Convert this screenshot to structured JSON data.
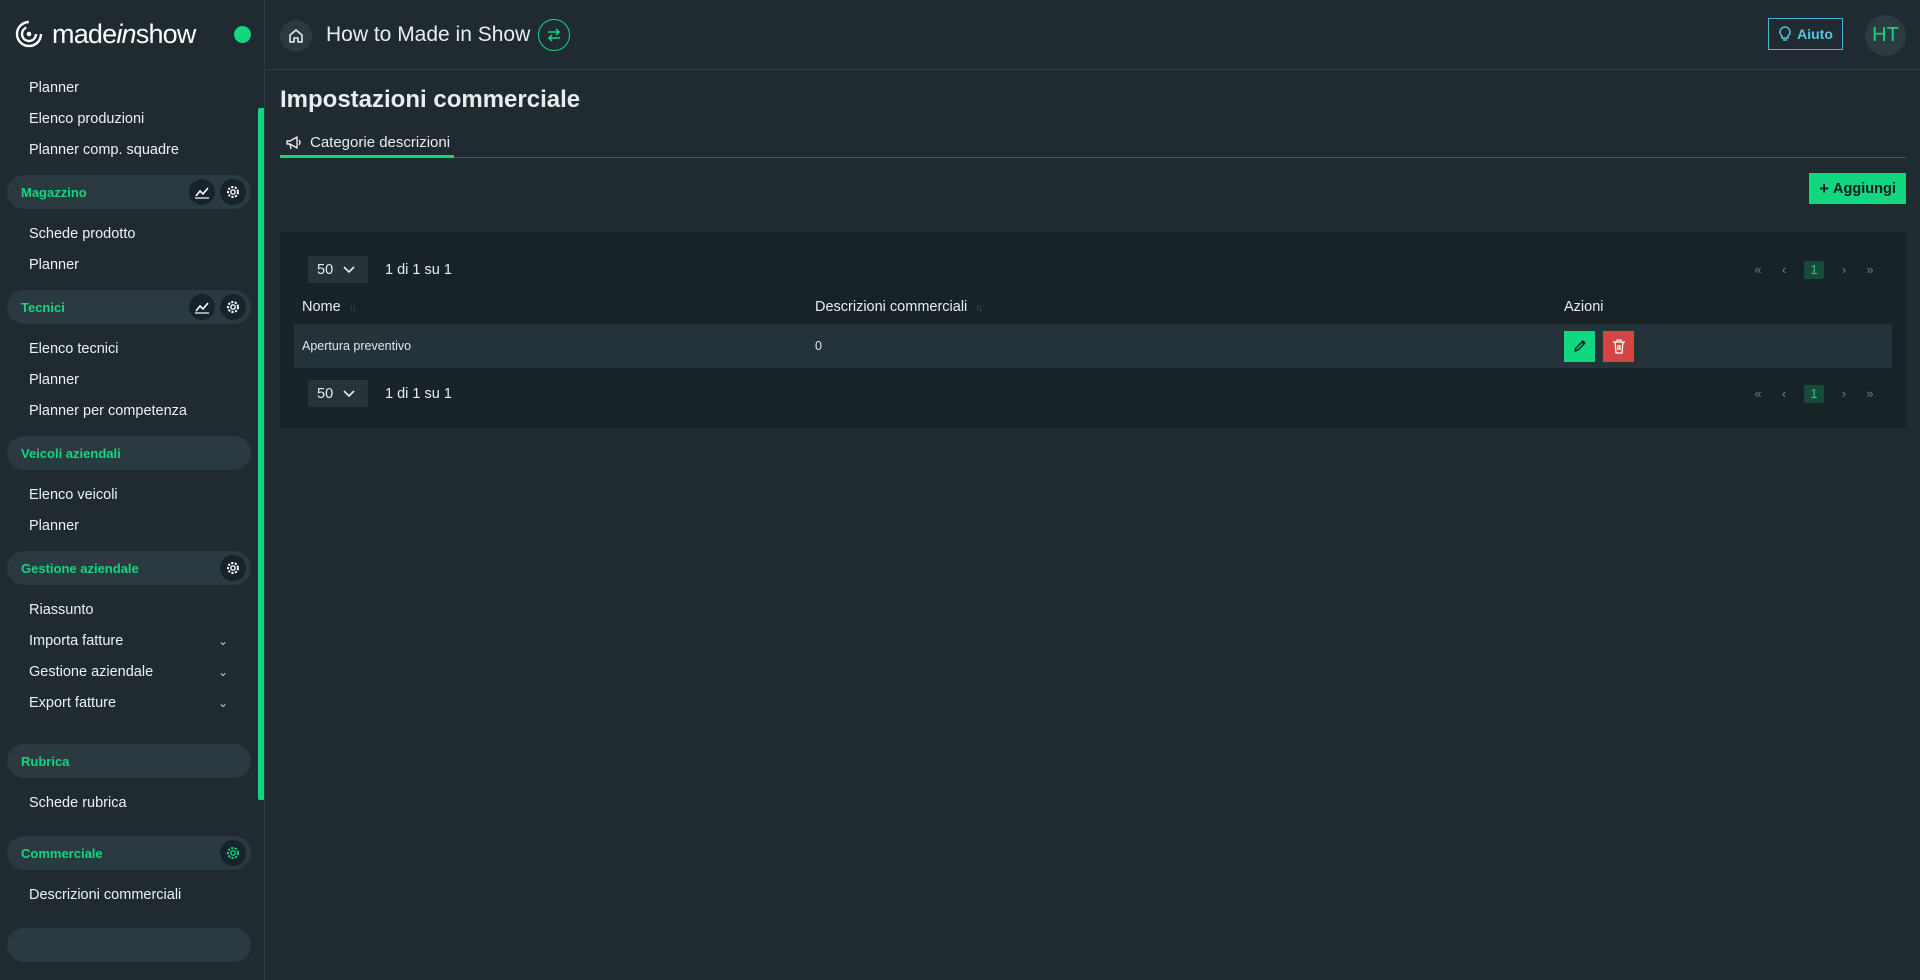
{
  "brand": {
    "name_pre": "made",
    "name_it": "in",
    "name_post": "show"
  },
  "colors": {
    "accent": "#13d680",
    "background": "#1f2b30",
    "danger": "#d64545",
    "help": "#56c6e0"
  },
  "sidebar": {
    "top_items": [
      "Planner",
      "Elenco produzioni",
      "Planner comp. squadre"
    ],
    "groups": [
      {
        "label": "Magazzino",
        "icons": [
          "chart-icon",
          "gear-icon"
        ],
        "items": [
          "Schede prodotto",
          "Planner"
        ]
      },
      {
        "label": "Tecnici",
        "icons": [
          "chart-icon",
          "gear-icon"
        ],
        "items": [
          "Elenco tecnici",
          "Planner",
          "Planner per competenza"
        ]
      },
      {
        "label": "Veicoli aziendali",
        "icons": [],
        "items": [
          "Elenco veicoli",
          "Planner"
        ]
      },
      {
        "label": "Gestione aziendale",
        "icons": [
          "gear-icon"
        ],
        "items": [
          "Riassunto",
          "Importa fatture",
          "Gestione aziendale",
          "Export fatture"
        ]
      },
      {
        "label": "Rubrica",
        "icons": [],
        "items": [
          "Schede rubrica"
        ]
      },
      {
        "label": "Commerciale",
        "icons": [
          "gear-icon"
        ],
        "items": [
          "Descrizioni commerciali"
        ]
      }
    ]
  },
  "header": {
    "title": "How to Made in Show",
    "help_label": "Aiuto",
    "avatar_initials": "HT"
  },
  "main": {
    "page_title": "Impostazioni commerciale",
    "tab_label": "Categorie descrizioni",
    "add_label": "Aggiungi",
    "page_size": "50",
    "page_info": "1 di 1 su 1",
    "current_page": "1",
    "columns": [
      "Nome",
      "Descrizioni commerciali",
      "Azioni"
    ],
    "rows": [
      {
        "nome": "Apertura preventivo",
        "descrizioni": "0"
      }
    ]
  }
}
